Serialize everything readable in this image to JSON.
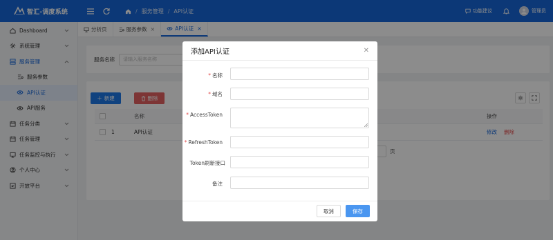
{
  "app": {
    "title": "智汇-调度系统"
  },
  "topbar": {
    "breadcrumbs": [
      "服务管理",
      "API认证"
    ],
    "feedback_label": "功能建议",
    "user_name": "管理员"
  },
  "sidebar": {
    "items": [
      {
        "label": "Dashboard",
        "icon": "home-icon",
        "has_children": true
      },
      {
        "label": "系统管理",
        "icon": "gear-icon",
        "has_children": true
      },
      {
        "label": "服务管理",
        "icon": "server-icon",
        "has_children": true,
        "open": true
      },
      {
        "label": "服务参数",
        "icon": "settings-list-icon",
        "sub": true
      },
      {
        "label": "API认证",
        "icon": "api-icon",
        "sub": true,
        "active": true
      },
      {
        "label": "API服务",
        "icon": "api-icon",
        "sub": true
      },
      {
        "label": "任务分类",
        "icon": "calendar-icon",
        "has_children": true
      },
      {
        "label": "任务管理",
        "icon": "calendar-icon",
        "has_children": true
      },
      {
        "label": "任务监控与执行",
        "icon": "monitor-icon",
        "has_children": true
      },
      {
        "label": "个人中心",
        "icon": "user-circle-icon",
        "has_children": true
      },
      {
        "label": "开放平台",
        "icon": "platform-icon",
        "has_children": true
      }
    ]
  },
  "tabs": [
    {
      "label": "分析页",
      "closable": false
    },
    {
      "label": "服务参数",
      "closable": true
    },
    {
      "label": "API认证",
      "closable": true,
      "active": true
    }
  ],
  "search": {
    "label": "服务名称",
    "placeholder": "请输入服务名称"
  },
  "toolbar": {
    "new_label": "新建",
    "delete_label": "删除"
  },
  "table": {
    "columns": [
      "名称",
      "操作"
    ],
    "rows": [
      {
        "index": "1",
        "name": "API认证",
        "edit": "修改",
        "delete": "删除"
      }
    ],
    "pager_suffix": "页"
  },
  "modal": {
    "title": "添加API认证",
    "fields": [
      {
        "label": "名称",
        "required": true,
        "value": ""
      },
      {
        "label": "域名",
        "required": true,
        "value": ""
      },
      {
        "label": "AccessToken",
        "required": true,
        "value": ""
      },
      {
        "label": "RefreshToken",
        "required": true,
        "value": ""
      },
      {
        "label": "Token刷新接口",
        "required": false,
        "value": ""
      },
      {
        "label": "备注",
        "required": false,
        "value": ""
      }
    ],
    "cancel_label": "取消",
    "save_label": "保存"
  },
  "colors": {
    "primary": "#1667d9",
    "danger": "#e24b4b",
    "save": "#4a96f0"
  }
}
